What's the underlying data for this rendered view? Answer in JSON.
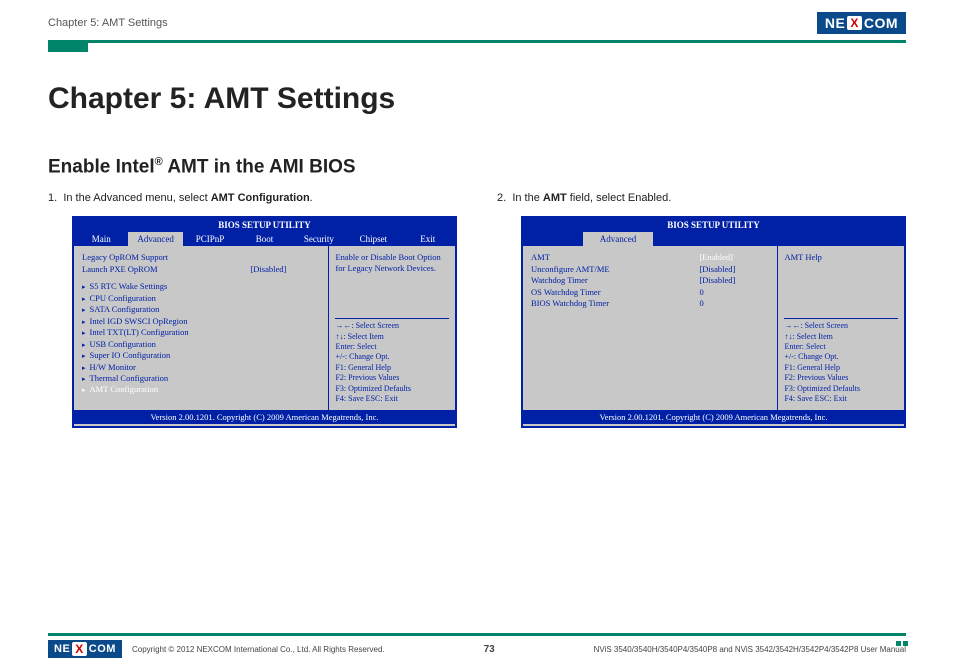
{
  "header": {
    "chapter_label": "Chapter 5: AMT Settings",
    "logo_text_1": "NE",
    "logo_x": "X",
    "logo_text_2": "COM"
  },
  "main": {
    "title": "Chapter 5: AMT Settings",
    "section_title_pre": "Enable Intel",
    "section_title_reg": "®",
    "section_title_post": " AMT in the AMI BIOS",
    "step1_num": "1.",
    "step1_pre": "In the Advanced menu, select ",
    "step1_bold": "AMT Configuration",
    "step1_post": ".",
    "step2_num": "2.",
    "step2_pre": "In the ",
    "step2_bold": "AMT",
    "step2_post": " field, select Enabled."
  },
  "bios1": {
    "title": "BIOS SETUP UTILITY",
    "tabs": [
      "Main",
      "Advanced",
      "PCIPnP",
      "Boot",
      "Security",
      "Chipset",
      "Exit"
    ],
    "active_tab": 1,
    "rows": [
      {
        "label": "Legacy OpROM Support",
        "val": ""
      },
      {
        "label": "Launch PXE OpROM",
        "val": "[Disabled]"
      }
    ],
    "items": [
      "S5 RTC Wake Settings",
      "CPU Configuration",
      "SATA Configuration",
      "Intel IGD SWSCI OpRegion",
      "Intel TXT(LT) Configuration",
      "USB Configuration",
      "Super IO Configuration",
      "H/W Monitor",
      "Thermal Configuration"
    ],
    "selected_item": "AMT Configuration",
    "help_top": "Enable or Disable Boot Option for Legacy Network Devices.",
    "help_lines": [
      "→←:   Select Screen",
      "↑↓:    Select Item",
      "Enter: Select",
      "+/-:    Change Opt.",
      "F1:     General Help",
      "F2:     Previous Values",
      "F3:     Optimized Defaults",
      "F4:     Save   ESC: Exit"
    ],
    "footer": "Version 2.00.1201. Copyright (C) 2009 American Megatrends, Inc."
  },
  "bios2": {
    "title": "BIOS SETUP UTILITY",
    "tab": "Advanced",
    "rows": [
      {
        "label": "AMT",
        "val": "[Enabled]",
        "sel": true
      },
      {
        "label": "Unconfigure AMT/ME",
        "val": "[Disabled]"
      },
      {
        "label": "Watchdog Timer",
        "val": "[Disabled]"
      },
      {
        "label": "  OS Watchdog Timer",
        "val": "0"
      },
      {
        "label": "  BIOS Watchdog Timer",
        "val": "0"
      }
    ],
    "help_top": "AMT Help",
    "help_lines": [
      "→←:   Select Screen",
      "↑↓:    Select Item",
      "Enter: Select",
      "+/-:    Change Opt.",
      "F1:     General Help",
      "F2:     Previous Values",
      "F3:     Optimized Defaults",
      "F4:     Save   ESC: Exit"
    ],
    "footer": "Version 2.00.1201. Copyright (C) 2009 American Megatrends, Inc."
  },
  "footer": {
    "copyright": "Copyright © 2012 NEXCOM International Co., Ltd. All Rights Reserved.",
    "page": "73",
    "models": "NViS 3540/3540H/3540P4/3540P8 and NViS 3542/3542H/3542P4/3542P8 User Manual"
  }
}
